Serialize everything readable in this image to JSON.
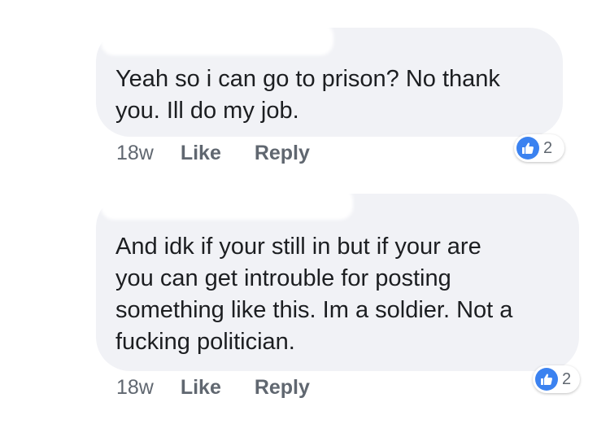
{
  "comments": [
    {
      "text": "Yeah so i can go to prison? No thank\nyou. Ill do my job.",
      "time": "18w",
      "like_label": "Like",
      "reply_label": "Reply",
      "reaction_count": "2"
    },
    {
      "text": "And idk if your still in but if your are\nyou can get introuble for posting\nsomething like this. Im a soldier. Not a\nfucking politician.",
      "time": "18w",
      "like_label": "Like",
      "reply_label": "Reply",
      "reaction_count": "2"
    }
  ],
  "icons": {
    "reaction": "thumbs-up-icon"
  },
  "colors": {
    "bubble": "#f1f2f6",
    "like_blue": "#3b82f0",
    "meta_gray": "#606770"
  }
}
